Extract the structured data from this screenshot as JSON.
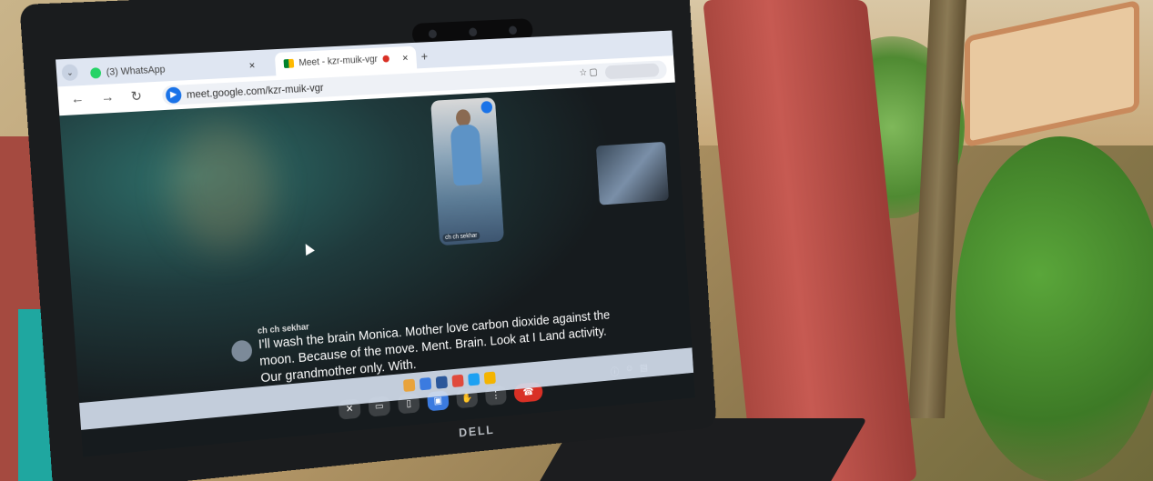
{
  "browser": {
    "tabs": [
      {
        "label": "(3) WhatsApp",
        "icon": "whatsapp-icon",
        "active": false
      },
      {
        "label": "Meet - kzr-muik-vgr",
        "icon": "google-meet-icon",
        "active": true
      }
    ],
    "url": "meet.google.com/kzr-muik-vgr"
  },
  "meet": {
    "tile_name": "ch ch sekhar",
    "caption": {
      "speaker": "ch ch sekhar",
      "text": "I'll wash the brain Monica. Mother love carbon dioxide against the moon. Because of the move. Ment. Brain. Look at I Land activity. Our grandmother only. With."
    }
  },
  "laptop": {
    "brand": "DELL"
  },
  "colors": {
    "chair": "#c0524a",
    "screen_bg": "#1f3a3c",
    "end_call": "#d93025",
    "tab_bar": "#dfe6f2"
  }
}
